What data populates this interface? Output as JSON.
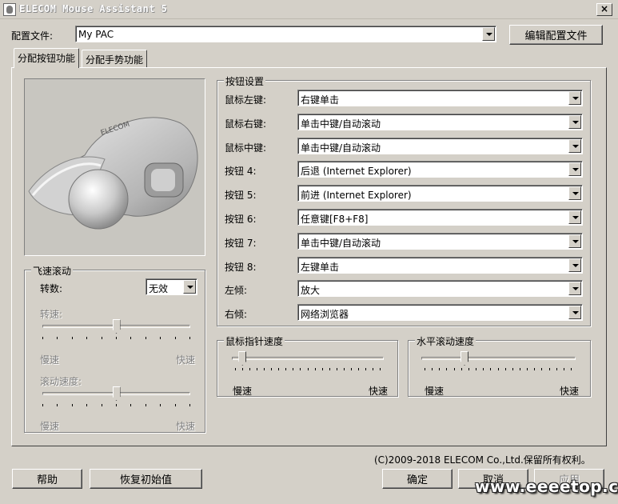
{
  "window": {
    "title": "ELECOM Mouse Assistant 5",
    "close_glyph": "×"
  },
  "profile": {
    "label": "配置文件:",
    "value": "My PAC",
    "edit_button": "编辑配置文件"
  },
  "tabs": [
    {
      "label": "分配按钮功能",
      "active": true
    },
    {
      "label": "分配手势功能",
      "active": false
    }
  ],
  "button_settings": {
    "title": "按钮设置",
    "rows": [
      {
        "label": "鼠标左键:",
        "value": "右键单击"
      },
      {
        "label": "鼠标右键:",
        "value": "单击中键/自动滚动"
      },
      {
        "label": "鼠标中键:",
        "value": "单击中键/自动滚动"
      },
      {
        "label": "按钮 4:",
        "value": "后退 (Internet Explorer)"
      },
      {
        "label": "按钮 5:",
        "value": "前进 (Internet Explorer)"
      },
      {
        "label": "按钮 6:",
        "value": "任意键[F8+F8]"
      },
      {
        "label": "按钮 7:",
        "value": "单击中键/自动滚动"
      },
      {
        "label": "按钮 8:",
        "value": "左键单击"
      },
      {
        "label": "左倾:",
        "value": "放大"
      },
      {
        "label": "右倾:",
        "value": "网络浏览器"
      }
    ]
  },
  "flying_scroll": {
    "title": "飞速滚动",
    "rotation_label": "转数:",
    "rotation_value": "无效",
    "speed_label": "转速:",
    "speed_slow": "慢速",
    "speed_fast": "快速",
    "speed_level": 0.5,
    "scroll_speed_label": "滚动速度:",
    "scroll_slow": "慢速",
    "scroll_fast": "快速",
    "scroll_level": 0.5
  },
  "pointer_speed": {
    "title": "鼠标指针速度",
    "slow": "慢速",
    "fast": "快速",
    "level": 0.07
  },
  "horizontal_scroll": {
    "title": "水平滚动速度",
    "slow": "慢速",
    "fast": "快速",
    "level": 0.28
  },
  "footer": {
    "copyright": "(C)2009-2018 ELECOM Co.,Ltd.保留所有权利。",
    "help": "帮助",
    "restore": "恢复初始值",
    "ok": "确定",
    "cancel": "取消",
    "apply": "应用"
  },
  "watermark": "www.eeeetop.com"
}
